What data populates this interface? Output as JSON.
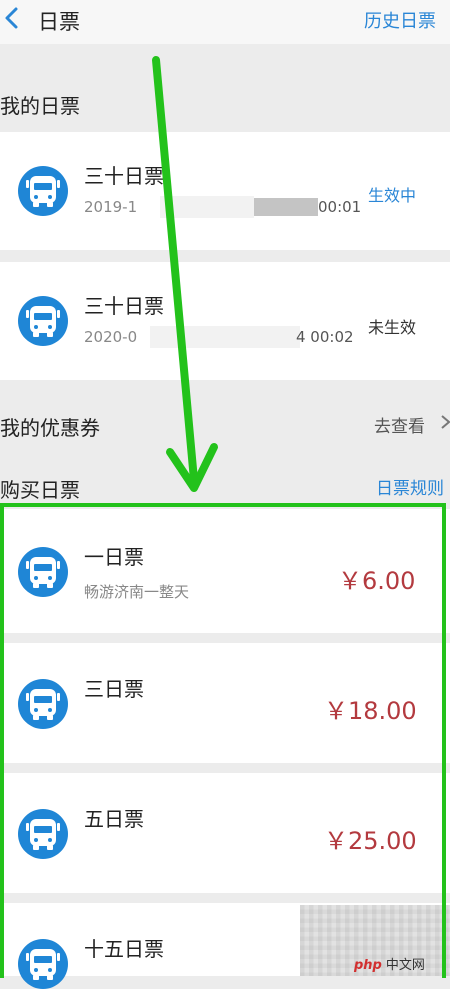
{
  "nav": {
    "back_icon": "chevron-left-icon",
    "title": "日票",
    "history_link": "历史日票"
  },
  "my_tickets": {
    "title": "我的日票",
    "items": [
      {
        "name": "三十日票",
        "date_start": "2019-1",
        "date_end": "00:01",
        "status": "生效中",
        "status_color": "#2a86d6",
        "icon": "bus-icon"
      },
      {
        "name": "三十日票",
        "date_start": "2020-0",
        "date_end": "4 00:02",
        "status": "未生效",
        "status_color": "#333333",
        "icon": "bus-icon"
      }
    ]
  },
  "coupons": {
    "title": "我的优惠券",
    "link": "去查看",
    "link_icon": "chevron-right-icon"
  },
  "buy": {
    "title": "购买日票",
    "rules_link": "日票规则",
    "items": [
      {
        "name": "一日票",
        "desc": "畅游济南一整天",
        "price": "￥6.00",
        "icon": "bus-icon"
      },
      {
        "name": "三日票",
        "desc": "",
        "price": "￥18.00",
        "icon": "bus-icon"
      },
      {
        "name": "五日票",
        "desc": "",
        "price": "￥25.00",
        "icon": "bus-icon"
      },
      {
        "name": "十五日票",
        "desc": "",
        "price": "",
        "icon": "bus-icon"
      }
    ]
  },
  "colors": {
    "accent": "#2a86d6",
    "price": "#b33a3f",
    "annotation_green": "#23c21b"
  },
  "watermark": {
    "logo_text": "php",
    "site_text": "中文网"
  }
}
